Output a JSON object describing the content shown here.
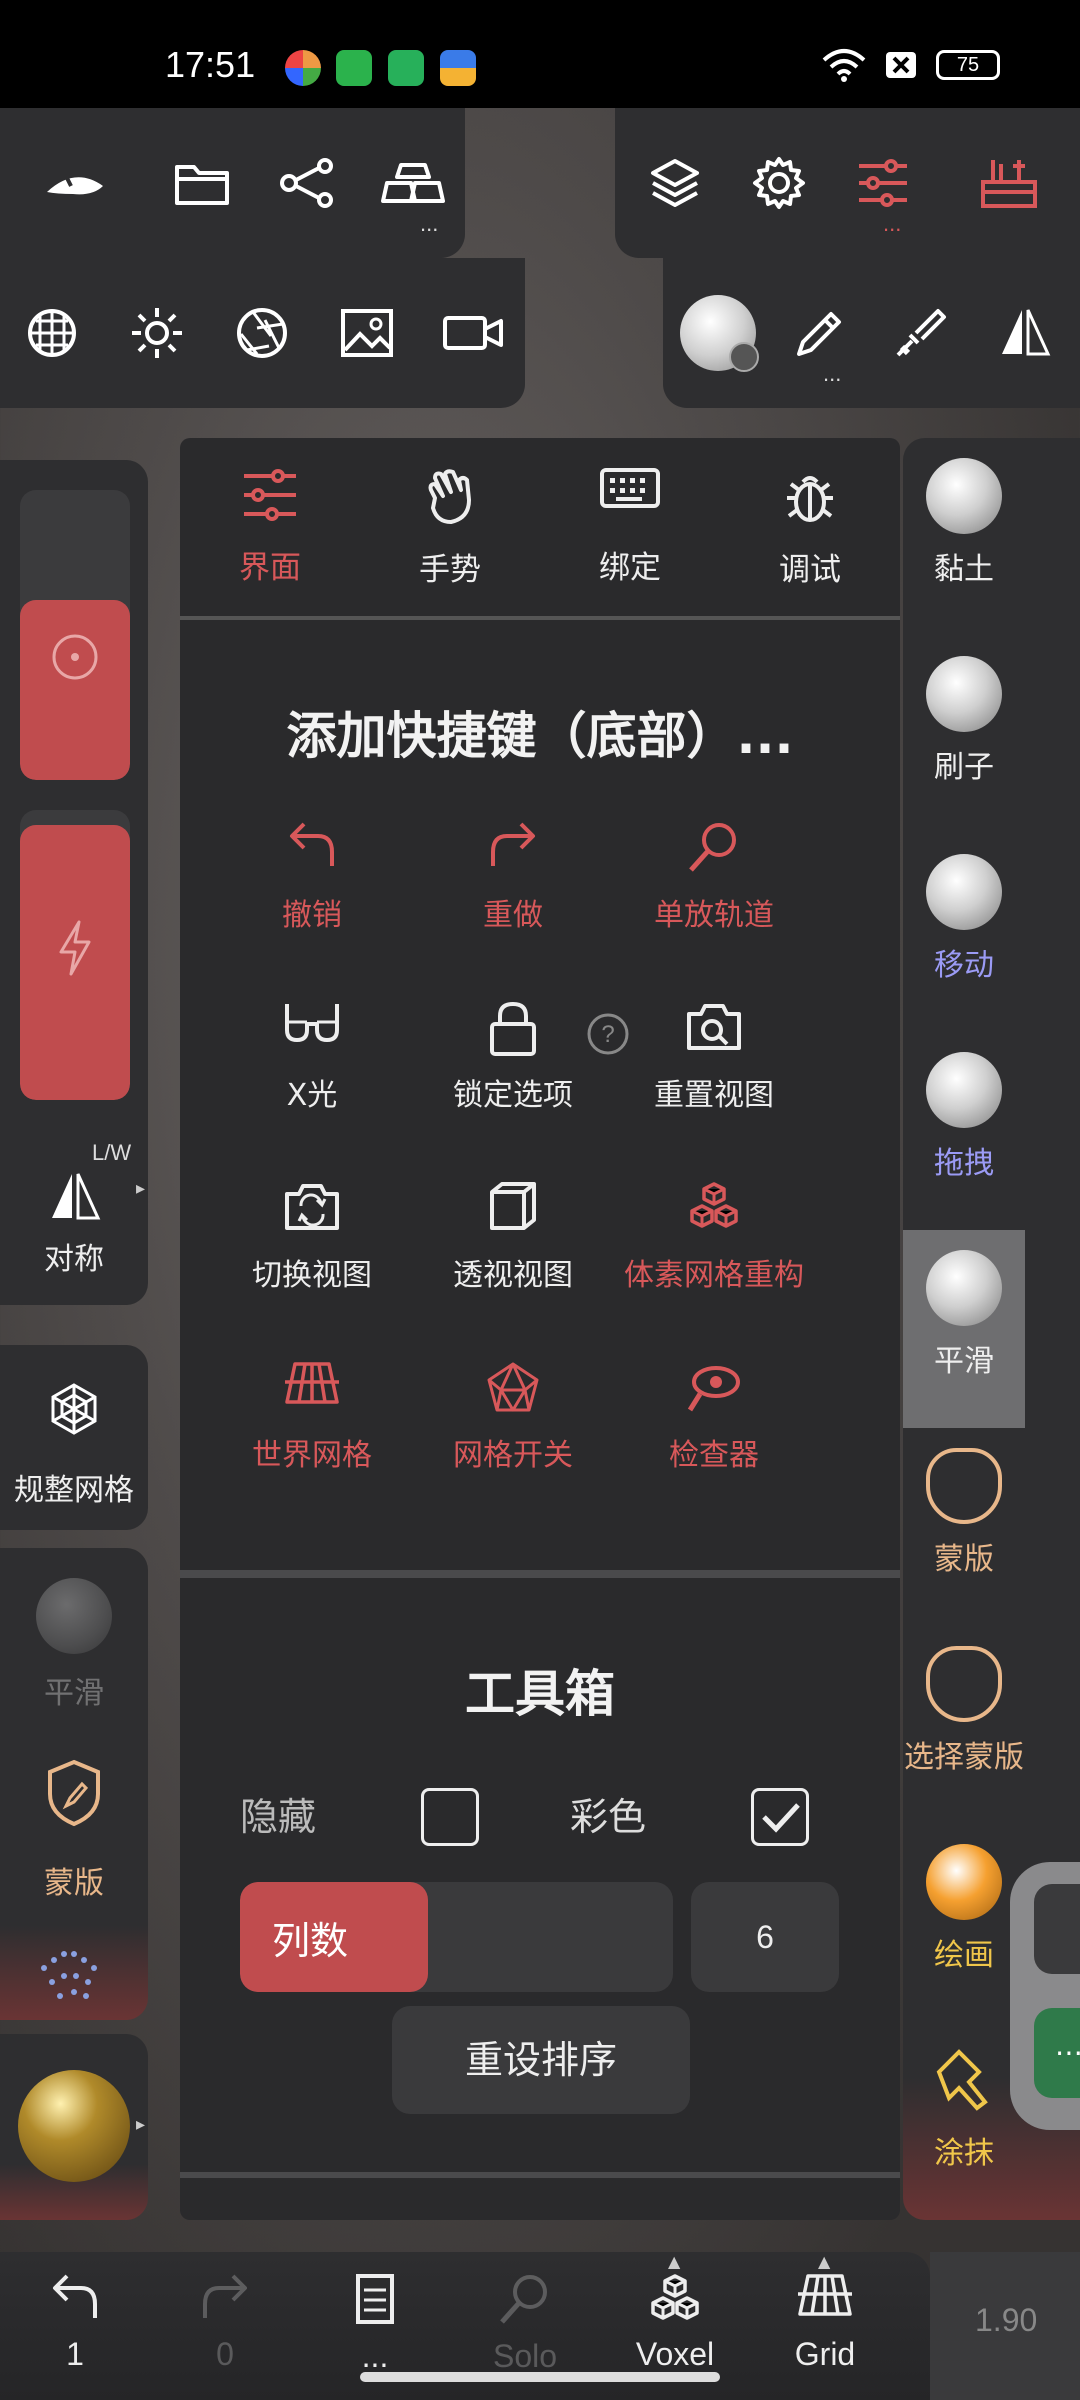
{
  "status_bar": {
    "time": "17:51",
    "battery": "75"
  },
  "colors": {
    "accent": "#d8585a",
    "panel_bg": "#2a2a2c",
    "active_tool_bg": "#6e6e70",
    "move_label": "#9b9bf5",
    "paint_label": "#f0c64a"
  },
  "top_toolbar": {
    "left_icons": [
      "app-logo-icon",
      "folder-icon",
      "share-icon",
      "gold-bars-icon"
    ],
    "right_icons": [
      "layers-icon",
      "gear-icon",
      "sliders-icon",
      "toolbox-icon"
    ],
    "second_row_icons": [
      "sphere-grid-icon",
      "sun-icon",
      "aperture-icon",
      "image-icon",
      "video-icon"
    ],
    "brush_row_icons": [
      "smooth-brush-icon",
      "pen-icon",
      "brush-icon",
      "symmetry-icon"
    ]
  },
  "settings_tabs": [
    {
      "label": "界面",
      "icon": "sliders-icon",
      "active": true
    },
    {
      "label": "手势",
      "icon": "hand-icon",
      "active": false
    },
    {
      "label": "绑定",
      "icon": "keyboard-icon",
      "active": false
    },
    {
      "label": "调试",
      "icon": "bug-icon",
      "active": false
    }
  ],
  "shortcuts": {
    "title": "添加快捷键（底部）...",
    "items": [
      {
        "label": "撤销",
        "icon": "undo-icon",
        "enabled": true
      },
      {
        "label": "重做",
        "icon": "redo-icon",
        "enabled": true
      },
      {
        "label": "单放轨道",
        "icon": "solo-icon",
        "enabled": true
      },
      {
        "label": "X光",
        "icon": "xray-glasses-icon",
        "enabled": false
      },
      {
        "label": "锁定选项",
        "icon": "lock-icon",
        "enabled": false
      },
      {
        "label": "重置视图",
        "icon": "reset-camera-icon",
        "enabled": false
      },
      {
        "label": "切换视图",
        "icon": "switch-camera-icon",
        "enabled": false
      },
      {
        "label": "透视视图",
        "icon": "perspective-cube-icon",
        "enabled": false
      },
      {
        "label": "体素网格重构",
        "icon": "voxel-icon",
        "enabled": true
      },
      {
        "label": "世界网格",
        "icon": "grid-icon",
        "enabled": true
      },
      {
        "label": "网格开关",
        "icon": "wireframe-icon",
        "enabled": true
      },
      {
        "label": "检查器",
        "icon": "inspector-icon",
        "enabled": true
      }
    ]
  },
  "toolbox": {
    "title": "工具箱",
    "hide_label": "隐藏",
    "hide_checked": false,
    "color_label": "彩色",
    "color_checked": true,
    "columns_label": "列数",
    "columns_value": "6",
    "columns_fraction": 0.434,
    "reset_label": "重设排序"
  },
  "right_tools": [
    {
      "label": "黏土",
      "color": "#eeeeee",
      "active": false
    },
    {
      "label": "刷子",
      "color": "#eeeeee",
      "active": false
    },
    {
      "label": "移动",
      "color": "#9b9bf5",
      "active": false
    },
    {
      "label": "拖拽",
      "color": "#9b9bf5",
      "active": false
    },
    {
      "label": "平滑",
      "color": "#eeeeee",
      "active": true
    },
    {
      "label": "蒙版",
      "color": "#e8b78a",
      "active": false
    },
    {
      "label": "选择蒙版",
      "color": "#e8b78a",
      "active": false
    },
    {
      "label": "绘画",
      "color": "#f0c64a",
      "active": false
    },
    {
      "label": "涂抹",
      "color": "#f0c64a",
      "active": false
    }
  ],
  "left_panel": {
    "symmetry_label": "对称",
    "symmetry_hint": "L/W",
    "regular_mesh_label": "规整网格",
    "smooth_label": "平滑",
    "mask_label": "蒙版"
  },
  "bottom_bar": [
    {
      "label": "1",
      "icon": "undo-icon",
      "dim": false
    },
    {
      "label": "0",
      "icon": "redo-icon",
      "dim": true
    },
    {
      "label": "...",
      "icon": "document-icon",
      "dim": false
    },
    {
      "label": "Solo",
      "icon": "solo-icon",
      "dim": true
    },
    {
      "label": "Voxel",
      "icon": "voxel-icon",
      "dim": false
    },
    {
      "label": "Grid",
      "icon": "grid-icon",
      "dim": false
    }
  ],
  "zoom_value": "1.90"
}
